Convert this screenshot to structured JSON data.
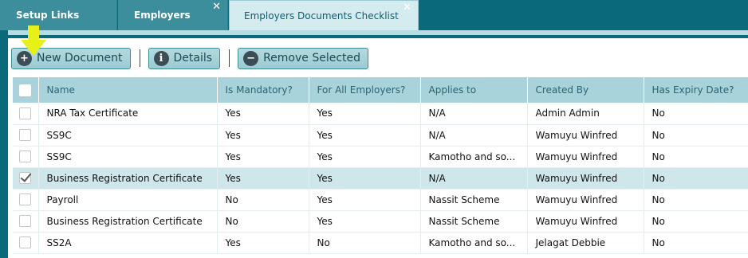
{
  "tabs": [
    {
      "label": "Setup Links",
      "closable": false,
      "active": false
    },
    {
      "label": "Employers",
      "closable": true,
      "active": false
    },
    {
      "label": "Employers Documents Checklist",
      "closable": true,
      "active": true
    }
  ],
  "toolbar": {
    "new_document": "New Document",
    "details": "Details",
    "remove_selected": "Remove Selected"
  },
  "table": {
    "columns": [
      "Name",
      "Is Mandatory?",
      "For All Employers?",
      "Applies to",
      "Created By",
      "Has Expiry Date?"
    ],
    "rows": [
      {
        "checked": false,
        "cells": [
          "NRA Tax Certificate",
          "Yes",
          "Yes",
          "N/A",
          "Admin Admin",
          "No"
        ]
      },
      {
        "checked": false,
        "cells": [
          "SS9C",
          "Yes",
          "Yes",
          "N/A",
          "Wamuyu Winfred",
          "No"
        ]
      },
      {
        "checked": false,
        "cells": [
          "SS9C",
          "Yes",
          "Yes",
          "Kamotho and so...",
          "Wamuyu Winfred",
          "No"
        ]
      },
      {
        "checked": true,
        "cells": [
          "Business Registration Certificate",
          "Yes",
          "Yes",
          "N/A",
          "Wamuyu Winfred",
          "No"
        ]
      },
      {
        "checked": false,
        "cells": [
          "Payroll",
          "No",
          "Yes",
          "Nassit Scheme",
          "Wamuyu Winfred",
          "No"
        ]
      },
      {
        "checked": false,
        "cells": [
          "Business Registration Certificate",
          "No",
          "Yes",
          "Nassit Scheme",
          "Wamuyu Winfred",
          "No"
        ]
      },
      {
        "checked": false,
        "cells": [
          "SS2A",
          "Yes",
          "No",
          "Kamotho and so...",
          "Jelagat Debbie",
          "No"
        ]
      }
    ]
  },
  "icons": {
    "close": "close-icon",
    "add": "plus-circle-icon",
    "info": "info-circle-icon",
    "remove": "minus-circle-icon",
    "pointer": "arrow-down-icon"
  },
  "colors": {
    "app_background": "#0a6a7c",
    "header_row": "#a8d3da",
    "selected_row": "#cfe6ea",
    "pointer_arrow": "#e8f01a"
  }
}
